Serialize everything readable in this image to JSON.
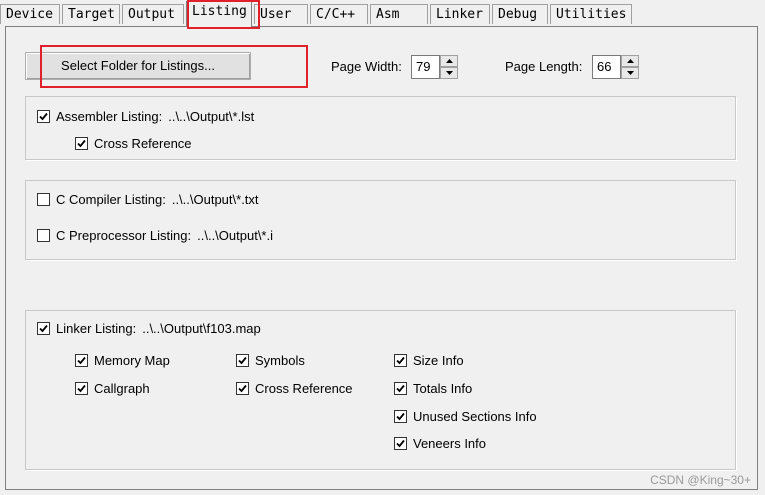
{
  "tabs": [
    "Device",
    "Target",
    "Output",
    "Listing",
    "User",
    "C/C++",
    "Asm",
    "Linker",
    "Debug",
    "Utilities"
  ],
  "active_tab": "Listing",
  "select_folder_button": "Select Folder for Listings...",
  "page_width": {
    "label": "Page Width:",
    "value": "79"
  },
  "page_length": {
    "label": "Page Length:",
    "value": "66"
  },
  "assembler": {
    "label": "Assembler Listing:",
    "path": "..\\..\\Output\\*.lst",
    "checked": true,
    "cross_reference": {
      "label": "Cross Reference",
      "checked": true
    }
  },
  "c_compiler": {
    "label": "C Compiler Listing:",
    "path": "..\\..\\Output\\*.txt",
    "checked": false
  },
  "c_preprocessor": {
    "label": "C Preprocessor Listing:",
    "path": "..\\..\\Output\\*.i",
    "checked": false
  },
  "linker": {
    "label": "Linker Listing:",
    "path": "..\\..\\Output\\f103.map",
    "checked": true,
    "options": {
      "memory_map": {
        "label": "Memory Map",
        "checked": true
      },
      "callgraph": {
        "label": "Callgraph",
        "checked": true
      },
      "symbols": {
        "label": "Symbols",
        "checked": true
      },
      "cross_reference": {
        "label": "Cross Reference",
        "checked": true
      },
      "size_info": {
        "label": "Size Info",
        "checked": true
      },
      "totals_info": {
        "label": "Totals Info",
        "checked": true
      },
      "unused_sections_info": {
        "label": "Unused Sections Info",
        "checked": true
      },
      "veneers_info": {
        "label": "Veneers Info",
        "checked": true
      }
    }
  },
  "watermark": "CSDN @King~30+",
  "colors": {
    "highlight_red": "#e0202a",
    "panel_bg": "#f0f0f0"
  }
}
